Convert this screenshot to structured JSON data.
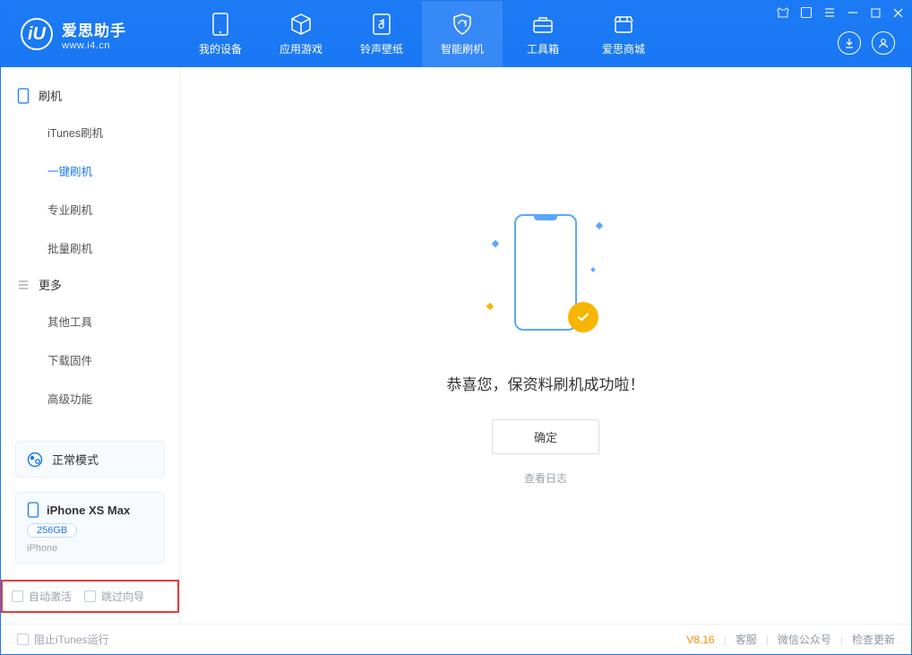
{
  "brand": {
    "name": "爱思助手",
    "url": "www.i4.cn",
    "logo_letter": "iU"
  },
  "nav": [
    {
      "label": "我的设备",
      "icon": "device-icon"
    },
    {
      "label": "应用游戏",
      "icon": "cube-icon"
    },
    {
      "label": "铃声壁纸",
      "icon": "music-note-icon"
    },
    {
      "label": "智能刷机",
      "icon": "shield-refresh-icon"
    },
    {
      "label": "工具箱",
      "icon": "toolbox-icon"
    },
    {
      "label": "爱思商城",
      "icon": "shop-icon"
    }
  ],
  "nav_active_index": 3,
  "window_controls": {
    "tshirt": "⬡",
    "page": "▭",
    "menu": "≡",
    "min": "—",
    "max": "▢",
    "close": "✕"
  },
  "header_buttons": {
    "download": "↓",
    "user": "◯"
  },
  "sidebar": {
    "group1": {
      "title": "刷机",
      "items": [
        "iTunes刷机",
        "一键刷机",
        "专业刷机",
        "批量刷机"
      ],
      "active_index": 1
    },
    "group2": {
      "title": "更多",
      "items": [
        "其他工具",
        "下载固件",
        "高级功能"
      ]
    }
  },
  "mode": {
    "label": "正常模式"
  },
  "device": {
    "name": "iPhone XS Max",
    "capacity": "256GB",
    "type": "iPhone"
  },
  "options": {
    "auto_activate": "自动激活",
    "skip_guide": "跳过向导"
  },
  "main": {
    "headline": "恭喜您，保资料刷机成功啦！",
    "ok_button": "确定",
    "view_log": "查看日志"
  },
  "footer": {
    "block_itunes": "阻止iTunes运行",
    "version": "V8.16",
    "links": [
      "客服",
      "微信公众号",
      "检查更新"
    ]
  }
}
